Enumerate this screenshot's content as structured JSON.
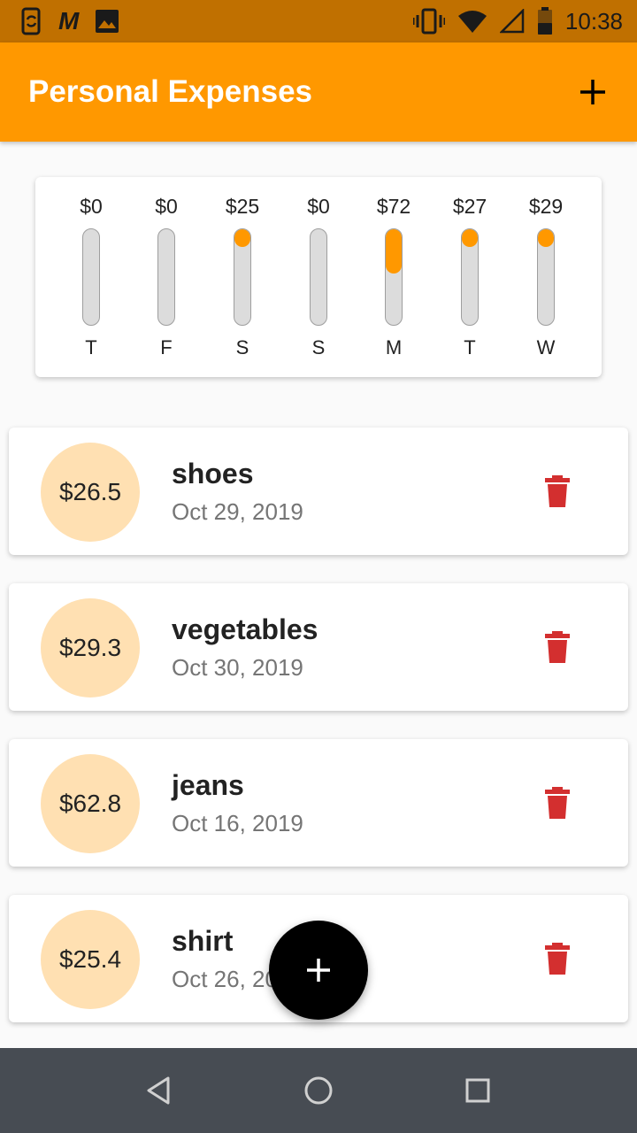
{
  "status_bar": {
    "time": "10:38",
    "carrier_logo": "M",
    "icons": [
      "phone-sync-icon",
      "gmail-icon",
      "image-icon",
      "vibrate-icon",
      "wifi-icon",
      "signal-icon",
      "battery-icon"
    ]
  },
  "app_bar": {
    "title": "Personal Expenses",
    "add_icon": "plus-icon",
    "color": "#ff9800"
  },
  "chart_data": {
    "type": "bar",
    "categories": [
      "T",
      "F",
      "S",
      "S",
      "M",
      "T",
      "W"
    ],
    "values": [
      0,
      0,
      25,
      0,
      72,
      27,
      29
    ],
    "labels": [
      "$0",
      "$0",
      "$25",
      "$0",
      "$72",
      "$27",
      "$29"
    ],
    "fill_fractions": [
      0,
      0,
      0.14,
      0,
      0.47,
      0.16,
      0.18
    ],
    "fill_color": "#ff9800",
    "track_color": "#dcdcdc"
  },
  "transactions": [
    {
      "amount": "$26.5",
      "title": "shoes",
      "date": "Oct 29, 2019"
    },
    {
      "amount": "$29.3",
      "title": "vegetables",
      "date": "Oct 30, 2019"
    },
    {
      "amount": "$62.8",
      "title": "jeans",
      "date": "Oct 16, 2019"
    },
    {
      "amount": "$25.4",
      "title": "shirt",
      "date": "Oct 26, 2019"
    }
  ],
  "fab": {
    "icon": "plus-icon",
    "color": "#000000"
  },
  "nav_bar": {
    "buttons": [
      "back-icon",
      "home-icon",
      "recents-icon"
    ]
  },
  "colors": {
    "status_bar": "#c07000",
    "amount_circle": "#ffe0b2",
    "delete_icon": "#d32f2f",
    "nav_bar": "#474c53"
  }
}
